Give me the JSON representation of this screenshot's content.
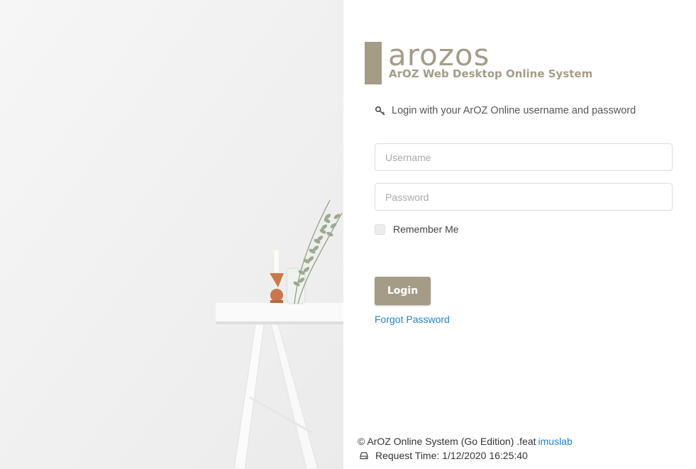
{
  "brand": {
    "title": "arozos",
    "subtitle": "ArOZ Web Desktop Online System",
    "accent_color": "#a59c88"
  },
  "login": {
    "intro_icon": "key-icon",
    "intro_text": "Login with your ArOZ Online username and password",
    "username_placeholder": "Username",
    "password_placeholder": "Password",
    "remember_label": "Remember Me",
    "remember_checked": false,
    "button_label": "Login",
    "forgot_label": "Forgot Password"
  },
  "footer": {
    "copyright": "© ArOZ Online System (Go Edition) .feat",
    "author_link": "imuslab",
    "request_icon": "hdd-icon",
    "request_time": "Request Time: 1/12/2020 16:25:40",
    "link_color": "#1e82d0"
  }
}
